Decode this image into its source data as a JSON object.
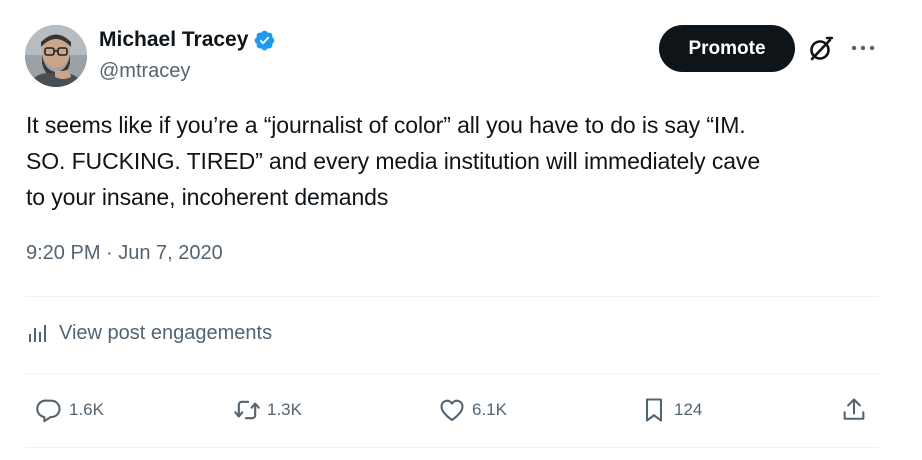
{
  "author": {
    "name": "Michael Tracey",
    "handle": "@mtracey",
    "verified": true,
    "avatar_icon": "avatar-photo"
  },
  "header": {
    "promote_label": "Promote",
    "grok_icon": "grok-icon",
    "more_icon": "more-icon"
  },
  "tweet": {
    "text_lines": [
      "It seems like if you’re a “journalist of color” all you have to do is say “IM.",
      "SO. FUCKING. TIRED” and every media institution will immediately cave",
      "to your insane, incoherent demands"
    ],
    "timestamp": "9:20 PM · Jun 7, 2020"
  },
  "engagements": {
    "label": "View post engagements",
    "icon": "analytics-icon"
  },
  "actions": {
    "reply": {
      "icon": "reply-icon",
      "count": "1.6K"
    },
    "repost": {
      "icon": "repost-icon",
      "count": "1.3K"
    },
    "like": {
      "icon": "like-icon",
      "count": "6.1K"
    },
    "bookmark": {
      "icon": "bookmark-icon",
      "count": "124"
    },
    "share": {
      "icon": "share-icon"
    }
  },
  "colors": {
    "text": "#0f1419",
    "secondary": "#536471",
    "verified": "#1d9bf0",
    "button_bg": "#0f1419",
    "divider": "#eff3f4"
  }
}
